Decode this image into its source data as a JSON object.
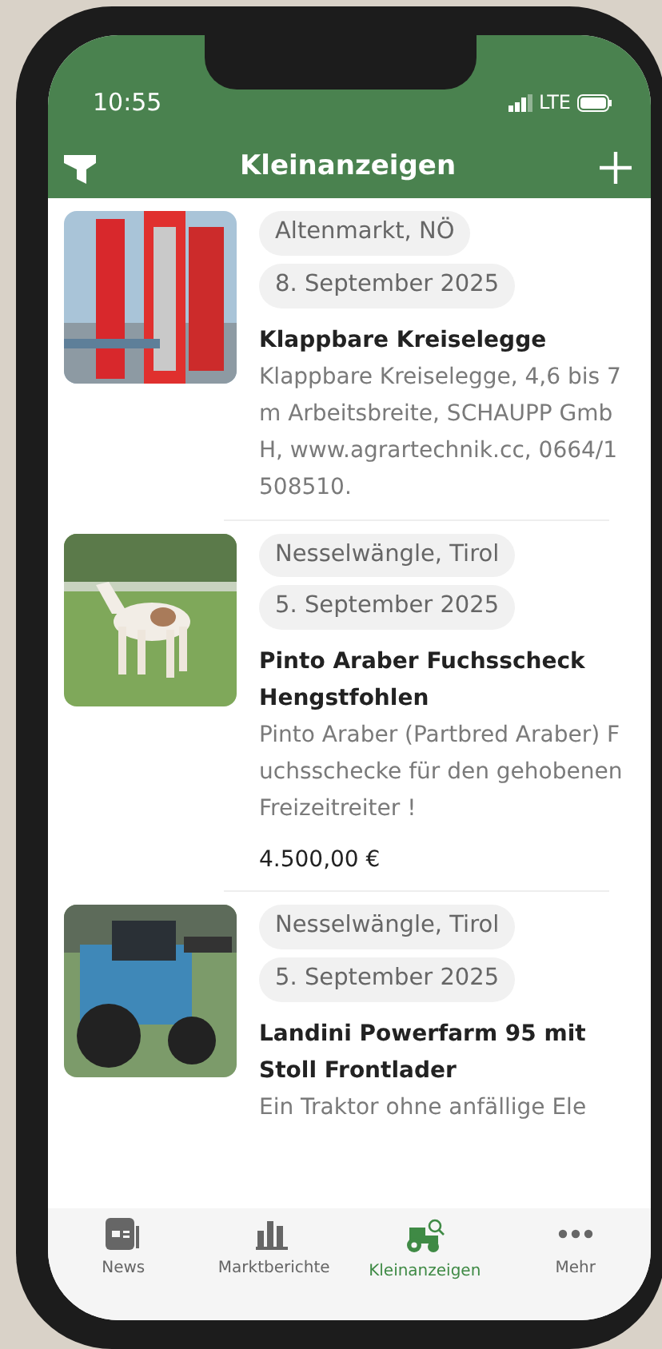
{
  "status_bar": {
    "time": "10:55",
    "network": "LTE"
  },
  "header": {
    "title": "Kleinanzeigen"
  },
  "listings": [
    {
      "location": "Altenmarkt, NÖ",
      "date": "8. September 2025",
      "title": "Klappbare Kreiselegge",
      "description": "Klappbare Kreiselegge, 4,6 bis 7 m Arbeitsbreite, SCHAUPP GmbH, www.agrartechnik.cc, 0664/1508510."
    },
    {
      "location": "Nesselwängle, Tirol",
      "date": "5. September 2025",
      "title": "Pinto Araber Fuchsscheck Hengstfohlen",
      "description": "Pinto Araber (Partbred Araber) Fuchsschecke für den gehobenen Freizeitreiter !",
      "price": "4.500,00 €"
    },
    {
      "location": "Nesselwängle, Tirol",
      "date": "5. September 2025",
      "title": "Landini Powerfarm 95 mit Stoll Frontlader",
      "description": "Ein Traktor ohne anfällige Ele"
    }
  ],
  "tab_bar": [
    {
      "label": "News",
      "selected": false
    },
    {
      "label": "Marktberichte",
      "selected": false
    },
    {
      "label": "Kleinanzeigen",
      "selected": true
    },
    {
      "label": "Mehr",
      "selected": false
    }
  ]
}
